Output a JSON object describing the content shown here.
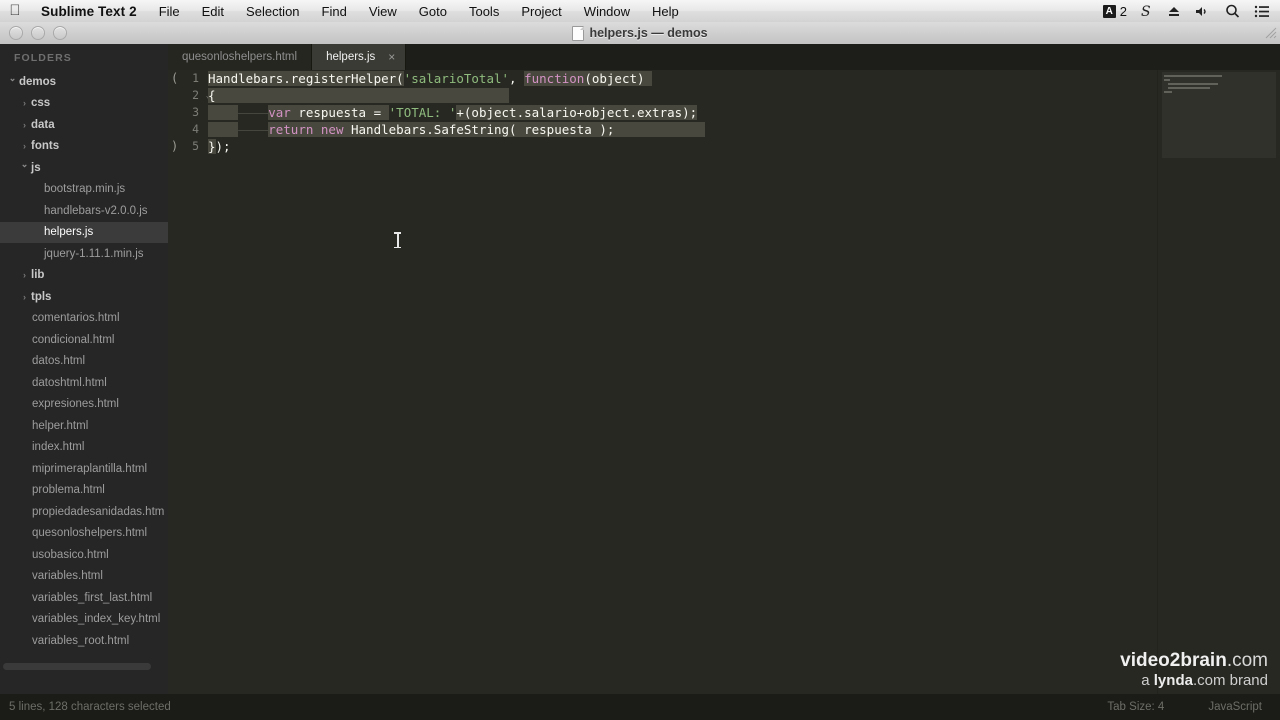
{
  "menubar": {
    "apple_icon": "apple-logo-icon",
    "app_name": "Sublime Text 2",
    "items": [
      "File",
      "Edit",
      "Selection",
      "Find",
      "View",
      "Goto",
      "Tools",
      "Project",
      "Window",
      "Help"
    ],
    "status_items": [
      {
        "name": "input-source-indicator",
        "label": "2"
      },
      {
        "name": "scrivener-icon",
        "label": "S"
      },
      {
        "name": "eject-icon",
        "label": ""
      },
      {
        "name": "volume-icon",
        "label": ""
      },
      {
        "name": "spotlight-search-icon",
        "label": ""
      },
      {
        "name": "notification-center-icon",
        "label": ""
      }
    ]
  },
  "window": {
    "title": "helpers.js — demos",
    "traffic_lights": [
      "close",
      "minimize",
      "zoom"
    ]
  },
  "sidebar": {
    "header": "FOLDERS",
    "tree": [
      {
        "label": "demos",
        "type": "folder",
        "indent": 0,
        "state": "open",
        "selected": false
      },
      {
        "label": "css",
        "type": "folder",
        "indent": 1,
        "state": "closed",
        "selected": false
      },
      {
        "label": "data",
        "type": "folder",
        "indent": 1,
        "state": "closed",
        "selected": false
      },
      {
        "label": "fonts",
        "type": "folder",
        "indent": 1,
        "state": "closed",
        "selected": false
      },
      {
        "label": "js",
        "type": "folder",
        "indent": 1,
        "state": "open",
        "selected": false
      },
      {
        "label": "bootstrap.min.js",
        "type": "file",
        "indent": 2,
        "state": "",
        "selected": false
      },
      {
        "label": "handlebars-v2.0.0.js",
        "type": "file",
        "indent": 2,
        "state": "",
        "selected": false
      },
      {
        "label": "helpers.js",
        "type": "file",
        "indent": 2,
        "state": "",
        "selected": true
      },
      {
        "label": "jquery-1.11.1.min.js",
        "type": "file",
        "indent": 2,
        "state": "",
        "selected": false
      },
      {
        "label": "lib",
        "type": "folder",
        "indent": 1,
        "state": "closed",
        "selected": false
      },
      {
        "label": "tpls",
        "type": "folder",
        "indent": 1,
        "state": "closed",
        "selected": false
      },
      {
        "label": "comentarios.html",
        "type": "file",
        "indent": 1,
        "state": "",
        "selected": false
      },
      {
        "label": "condicional.html",
        "type": "file",
        "indent": 1,
        "state": "",
        "selected": false
      },
      {
        "label": "datos.html",
        "type": "file",
        "indent": 1,
        "state": "",
        "selected": false
      },
      {
        "label": "datoshtml.html",
        "type": "file",
        "indent": 1,
        "state": "",
        "selected": false
      },
      {
        "label": "expresiones.html",
        "type": "file",
        "indent": 1,
        "state": "",
        "selected": false
      },
      {
        "label": "helper.html",
        "type": "file",
        "indent": 1,
        "state": "",
        "selected": false
      },
      {
        "label": "index.html",
        "type": "file",
        "indent": 1,
        "state": "",
        "selected": false
      },
      {
        "label": "miprimeraplantilla.html",
        "type": "file",
        "indent": 1,
        "state": "",
        "selected": false
      },
      {
        "label": "problema.html",
        "type": "file",
        "indent": 1,
        "state": "",
        "selected": false
      },
      {
        "label": "propiedadesanidadas.htm",
        "type": "file",
        "indent": 1,
        "state": "",
        "selected": false
      },
      {
        "label": "quesonloshelpers.html",
        "type": "file",
        "indent": 1,
        "state": "",
        "selected": false
      },
      {
        "label": "usobasico.html",
        "type": "file",
        "indent": 1,
        "state": "",
        "selected": false
      },
      {
        "label": "variables.html",
        "type": "file",
        "indent": 1,
        "state": "",
        "selected": false
      },
      {
        "label": "variables_first_last.html",
        "type": "file",
        "indent": 1,
        "state": "",
        "selected": false
      },
      {
        "label": "variables_index_key.html",
        "type": "file",
        "indent": 1,
        "state": "",
        "selected": false
      },
      {
        "label": "variables_root.html",
        "type": "file",
        "indent": 1,
        "state": "",
        "selected": false
      }
    ]
  },
  "tabs": [
    {
      "label": "quesonloshelpers.html",
      "active": false,
      "closable": false
    },
    {
      "label": "helpers.js",
      "active": true,
      "closable": true,
      "close_label": "×"
    }
  ],
  "editor": {
    "line_numbers": [
      "1",
      "2",
      "3",
      "4",
      "5"
    ],
    "bracket_open_marker": "(",
    "bracket_close_marker": ")",
    "fold_marker": "⌄",
    "lines": [
      "Handlebars.registerHelper('salarioTotal', function(object)",
      "{",
      "    var respuesta = 'TOTAL: '+(object.salario+object.extras);",
      "    return new Handlebars.SafeString( respuesta );",
      "});"
    ],
    "selection_text": "5 lines, 128 characters selected",
    "cursor_line": 5
  },
  "statusbar": {
    "left": "5 lines, 128 characters selected",
    "tab_size": "Tab Size: 4",
    "syntax": "JavaScript"
  },
  "watermark": {
    "line1_bold": "video2brain",
    "line1_dim": ".com",
    "line2_a": "a ",
    "line2_bold": "lynda",
    "line2_rest": ".com brand"
  },
  "colors": {
    "background": "#272822",
    "sidebar": "#262626",
    "selection": "#49483e",
    "keyword": "#d292c3",
    "string": "#8fbc7e",
    "text": "#f8f8f2",
    "statusbar": "#1b1c17"
  }
}
